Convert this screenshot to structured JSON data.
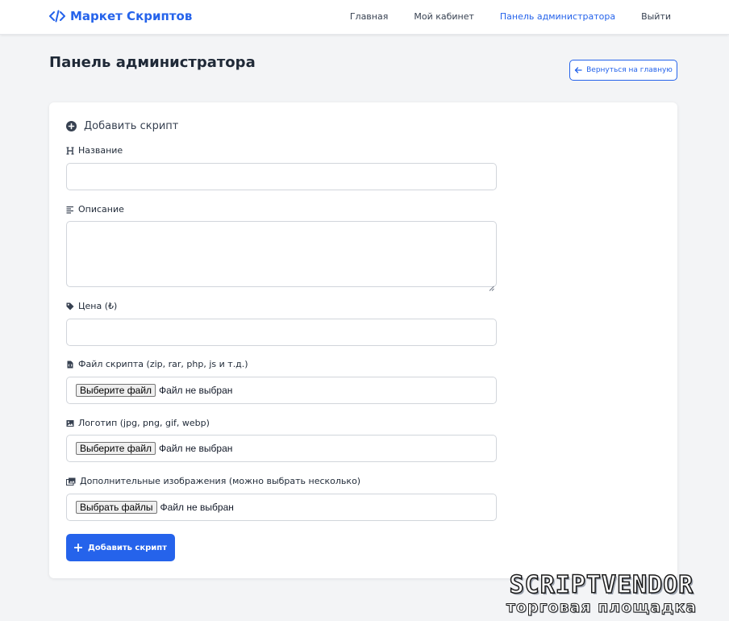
{
  "header": {
    "brand_label": "Маркет Скриптов",
    "brand_icon": "code-icon",
    "nav": [
      {
        "label": "Главная",
        "active": false
      },
      {
        "label": "Мой кабинет",
        "active": false
      },
      {
        "label": "Панель администратора",
        "active": true
      },
      {
        "label": "Выйти",
        "active": false
      }
    ]
  },
  "page": {
    "title": "Панель администратора",
    "back_button_label": "Вернуться на главную",
    "back_button_icon": "arrow-left-icon"
  },
  "form": {
    "title": "Добавить скрипт",
    "title_icon": "plus-circle-icon",
    "fields": {
      "name": {
        "label": "Название",
        "icon": "heading-icon",
        "value": ""
      },
      "description": {
        "label": "Описание",
        "icon": "align-left-icon",
        "value": ""
      },
      "price": {
        "label": "Цена (₺)",
        "icon": "tag-icon",
        "value": ""
      },
      "script_file": {
        "label": "Файл скрипта (zip, rar, php, js и т.д.)",
        "icon": "file-code-icon",
        "button_label": "Выберите файл",
        "status": "Файл не выбран"
      },
      "logo": {
        "label": "Логотип (jpg, png, gif, webp)",
        "icon": "image-icon",
        "button_label": "Выберите файл",
        "status": "Файл не выбран"
      },
      "extra_images": {
        "label": "Дополнительные изображения (можно выбрать несколько)",
        "icon": "images-icon",
        "button_label": "Выбрать файлы",
        "status": "Файл не выбран"
      }
    },
    "submit_label": "Добавить скрипт",
    "submit_icon": "plus-icon"
  },
  "watermark": {
    "title": "SCRIPTVENDOR",
    "subtitle": "торговая площадка"
  },
  "colors": {
    "accent": "#2563eb",
    "background": "#f3f4f6",
    "card": "#ffffff",
    "border": "#d1d5db",
    "text": "#1f2937"
  }
}
